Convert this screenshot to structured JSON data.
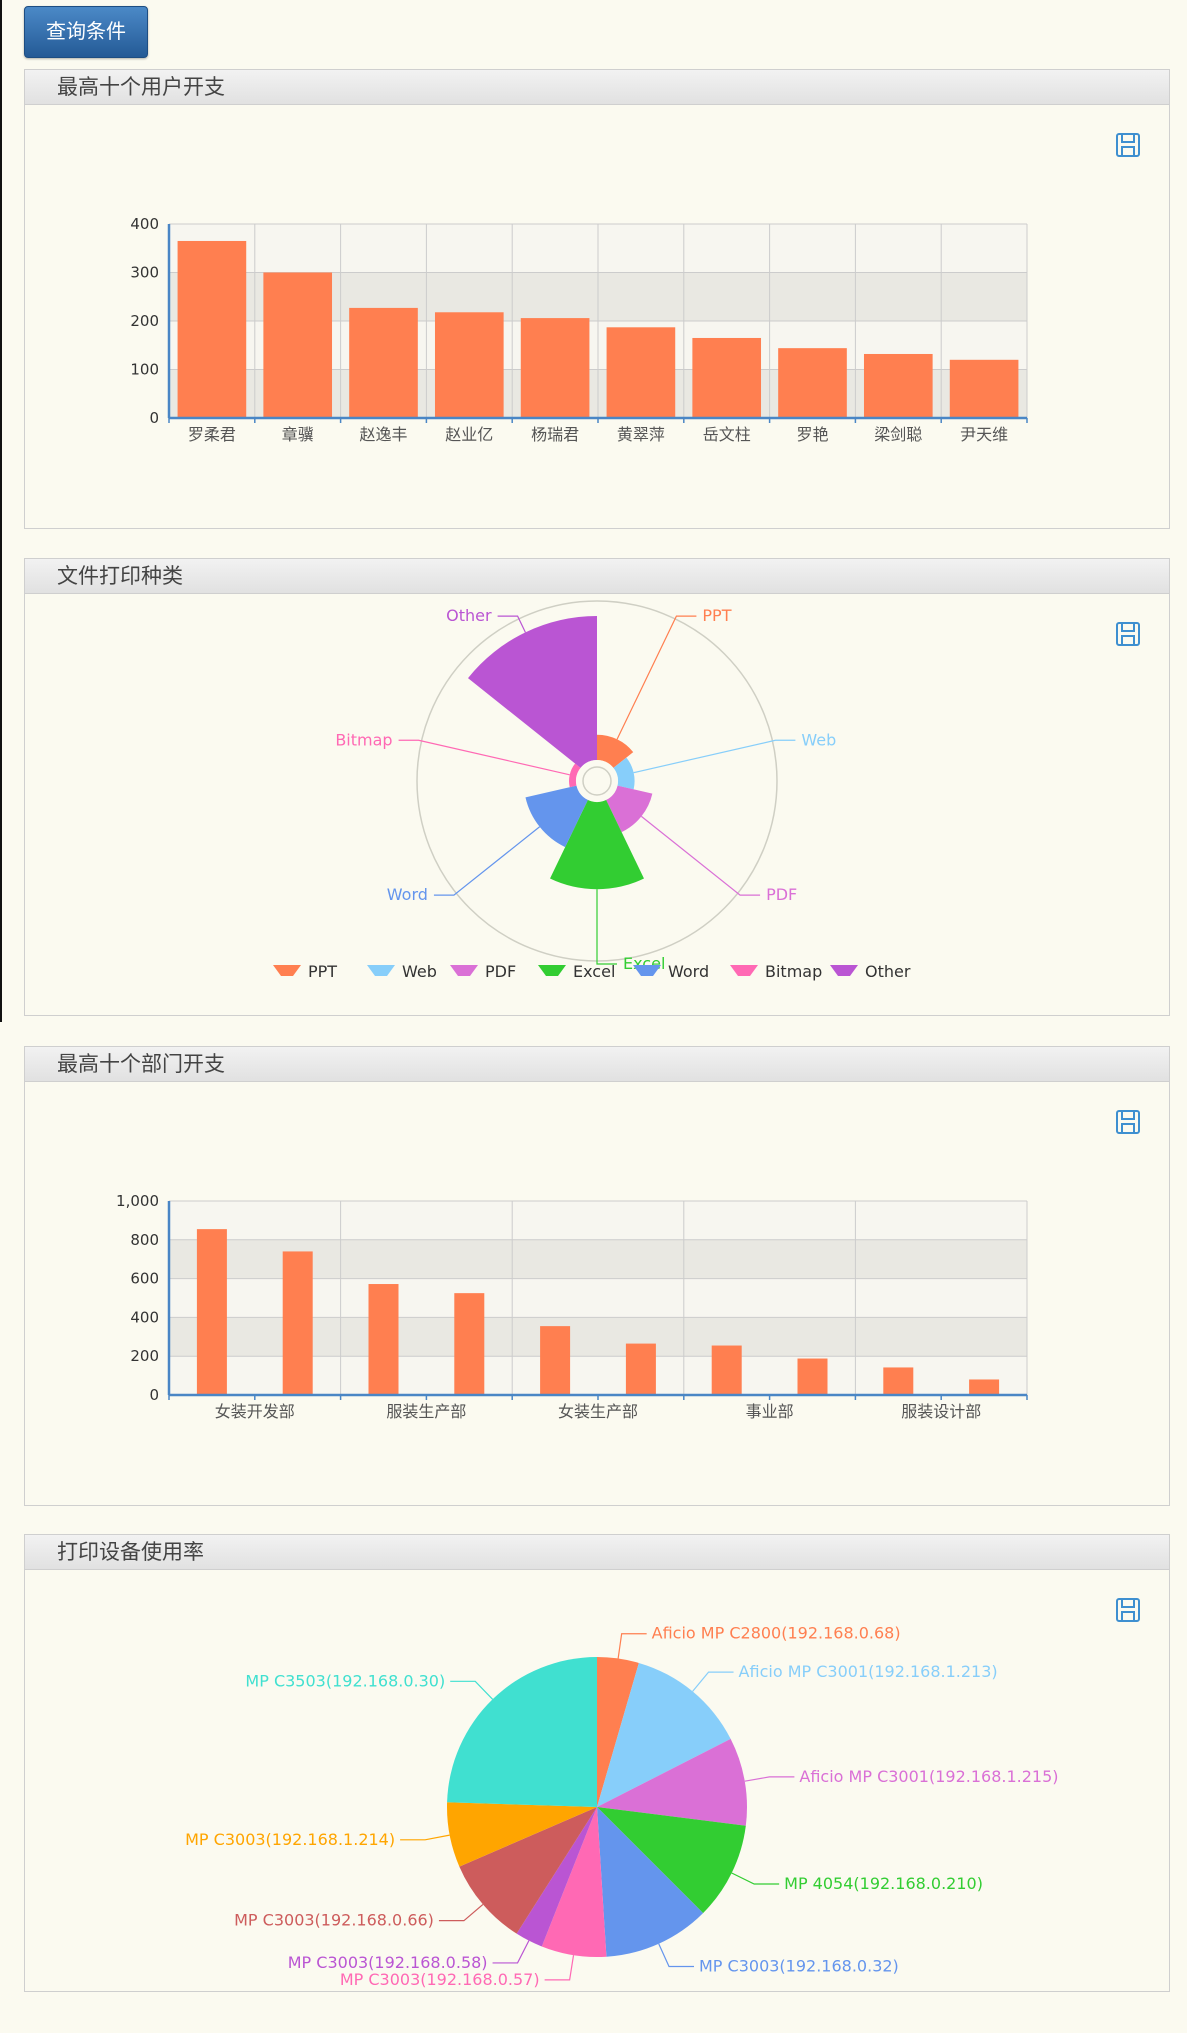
{
  "query_button": "查询条件",
  "panels": [
    {
      "title": "最高十个用户开支"
    },
    {
      "title": "文件打印种类"
    },
    {
      "title": "最高十个部门开支"
    },
    {
      "title": "打印设备使用率"
    }
  ],
  "chart_data": [
    {
      "type": "bar",
      "title": "最高十个用户开支",
      "categories": [
        "罗柔君",
        "章骥",
        "赵逸丰",
        "赵业亿",
        "杨瑞君",
        "黄翠萍",
        "岳文柱",
        "罗艳",
        "梁剑聪",
        "尹天维"
      ],
      "values": [
        365,
        300,
        227,
        218,
        206,
        187,
        165,
        144,
        132,
        120
      ],
      "ylim": [
        0,
        400
      ],
      "yticks": [
        "0",
        "100",
        "200",
        "300",
        "400"
      ],
      "color": "#ff7f50",
      "grid": true
    },
    {
      "type": "pie",
      "subtype": "rose",
      "title": "文件打印种类",
      "labels": [
        "PPT",
        "Web",
        "PDF",
        "Excel",
        "Word",
        "Bitmap",
        "Other"
      ],
      "values": [
        29,
        19,
        41,
        100,
        60,
        8,
        165
      ],
      "colors": [
        "#ff7f50",
        "#87cefa",
        "#da70d6",
        "#32cd32",
        "#6495ed",
        "#ff69b4",
        "#ba55d3"
      ],
      "legend": "bottom"
    },
    {
      "type": "bar",
      "title": "最高十个部门开支",
      "categories": [
        "女装开发部",
        "",
        "服装生产部",
        "",
        "女装生产部",
        "",
        "事业部",
        "",
        "服装设计部",
        ""
      ],
      "values": [
        855,
        740,
        572,
        525,
        355,
        265,
        255,
        188,
        142,
        80
      ],
      "ylim": [
        0,
        1000
      ],
      "yticks": [
        "0",
        "200",
        "400",
        "600",
        "800",
        "1,000"
      ],
      "color": "#ff7f50",
      "grid": true
    },
    {
      "type": "pie",
      "title": "打印设备使用率",
      "labels": [
        "Aficio MP C2800(192.168.0.68)",
        "Aficio MP C3001(192.168.1.213)",
        "Aficio MP C3001(192.168.1.215)",
        "MP 4054(192.168.0.210)",
        "MP C3003(192.168.0.32)",
        "MP C3003(192.168.0.57)",
        "MP C3003(192.168.0.58)",
        "MP C3003(192.168.0.66)",
        "MP C3003(192.168.1.214)",
        "MP C3503(192.168.0.30)"
      ],
      "values": [
        4.5,
        13,
        9.5,
        10.5,
        11.5,
        7,
        3,
        9.5,
        7,
        24.5
      ],
      "colors": [
        "#ff7f50",
        "#87cefa",
        "#da70d6",
        "#32cd32",
        "#6495ed",
        "#ff69b4",
        "#ba55d3",
        "#cd5c5c",
        "#ffa500",
        "#40e0d0"
      ]
    }
  ]
}
